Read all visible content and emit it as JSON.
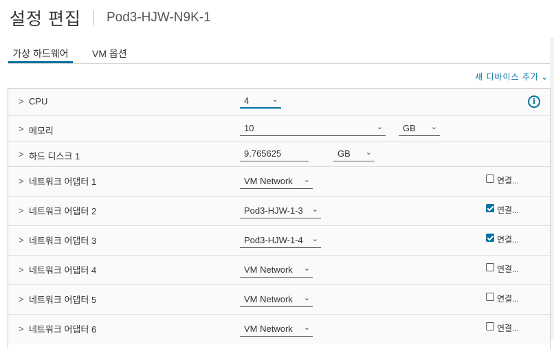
{
  "header": {
    "title": "설정 편집",
    "subtitle": "Pod3-HJW-N9K-1"
  },
  "tabs": [
    {
      "label": "가상 하드웨어"
    },
    {
      "label": "VM 옵션"
    }
  ],
  "add_device": {
    "label": "새 디바이스 추가"
  },
  "rows": {
    "cpu": {
      "label": "CPU",
      "value": "4"
    },
    "memory": {
      "label": "메모리",
      "value": "10",
      "unit": "GB"
    },
    "disk": {
      "label": "하드 디스크 1",
      "value": "9.765625",
      "unit": "GB"
    },
    "nics": [
      {
        "label": "네트워크 어댑터 1",
        "network": "VM Network",
        "connected": false,
        "connect_label": "연결..."
      },
      {
        "label": "네트워크 어댑터 2",
        "network": "Pod3-HJW-1-3",
        "connected": true,
        "connect_label": "연결..."
      },
      {
        "label": "네트워크 어댑터 3",
        "network": "Pod3-HJW-1-4",
        "connected": true,
        "connect_label": "연결..."
      },
      {
        "label": "네트워크 어댑터 4",
        "network": "VM Network",
        "connected": false,
        "connect_label": "연결..."
      },
      {
        "label": "네트워크 어댑터 5",
        "network": "VM Network",
        "connected": false,
        "connect_label": "연결..."
      },
      {
        "label": "네트워크 어댑터 6",
        "network": "VM Network",
        "connected": false,
        "connect_label": "연결..."
      }
    ]
  }
}
